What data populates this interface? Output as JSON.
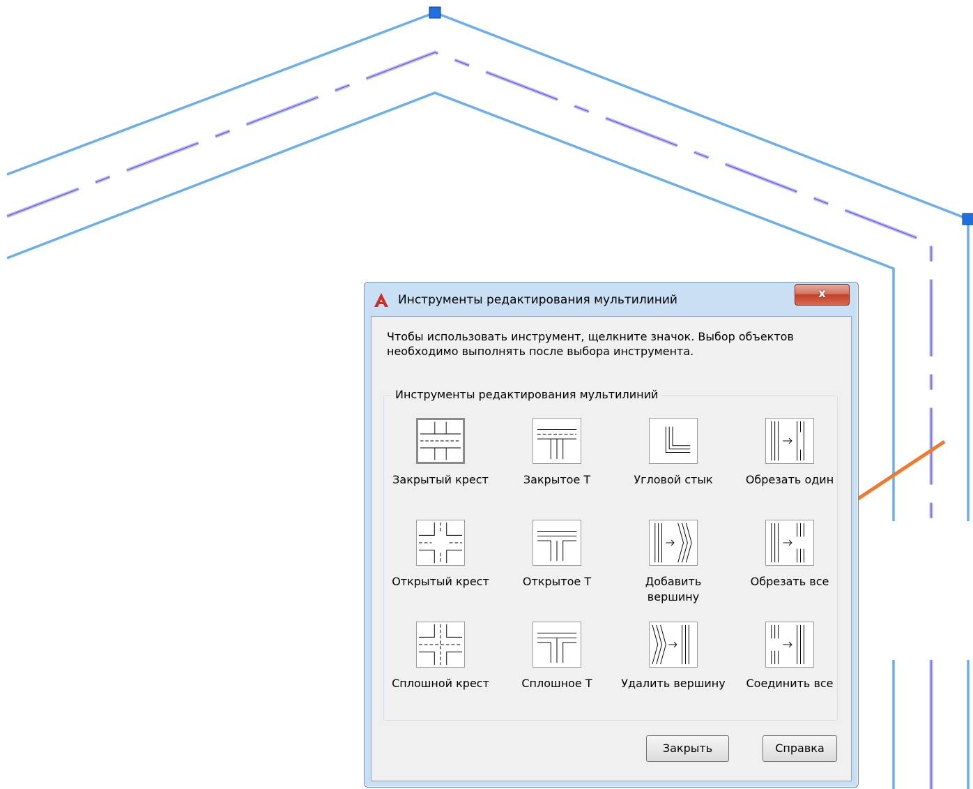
{
  "dialog": {
    "title": "Инструменты редактирования мультилиний",
    "close_symbol": "x",
    "instructions": "Чтобы использовать инструмент, щелкните значок. Выбор объектов необходимо выполнять после выбора инструмента.",
    "group_label": "Инструменты редактирования мультилиний",
    "tools": [
      {
        "label": "Закрытый крест",
        "icon": "closed-cross-icon",
        "selected": true
      },
      {
        "label": "Закрытое T",
        "icon": "closed-tee-icon"
      },
      {
        "label": "Угловой стык",
        "icon": "corner-joint-icon"
      },
      {
        "label": "Обрезать один",
        "icon": "cut-single-icon"
      },
      {
        "label": "Открытый крест",
        "icon": "open-cross-icon"
      },
      {
        "label": "Открытое T",
        "icon": "open-tee-icon"
      },
      {
        "label": "Добавить вершину",
        "icon": "add-vertex-icon"
      },
      {
        "label": "Обрезать все",
        "icon": "cut-all-icon"
      },
      {
        "label": "Сплошной крест",
        "icon": "merged-cross-icon"
      },
      {
        "label": "Сплошное T",
        "icon": "merged-tee-icon"
      },
      {
        "label": "Удалить вершину",
        "icon": "delete-vertex-icon"
      },
      {
        "label": "Соединить все",
        "icon": "weld-all-icon"
      }
    ],
    "buttons": {
      "close": "Закрыть",
      "help": "Справка"
    }
  },
  "colors": {
    "multiline_outer": "#6aaeea",
    "multiline_center": "#b044e0",
    "grip": "#1f6fe0",
    "annotation_arrow": "#ef7a2c"
  }
}
